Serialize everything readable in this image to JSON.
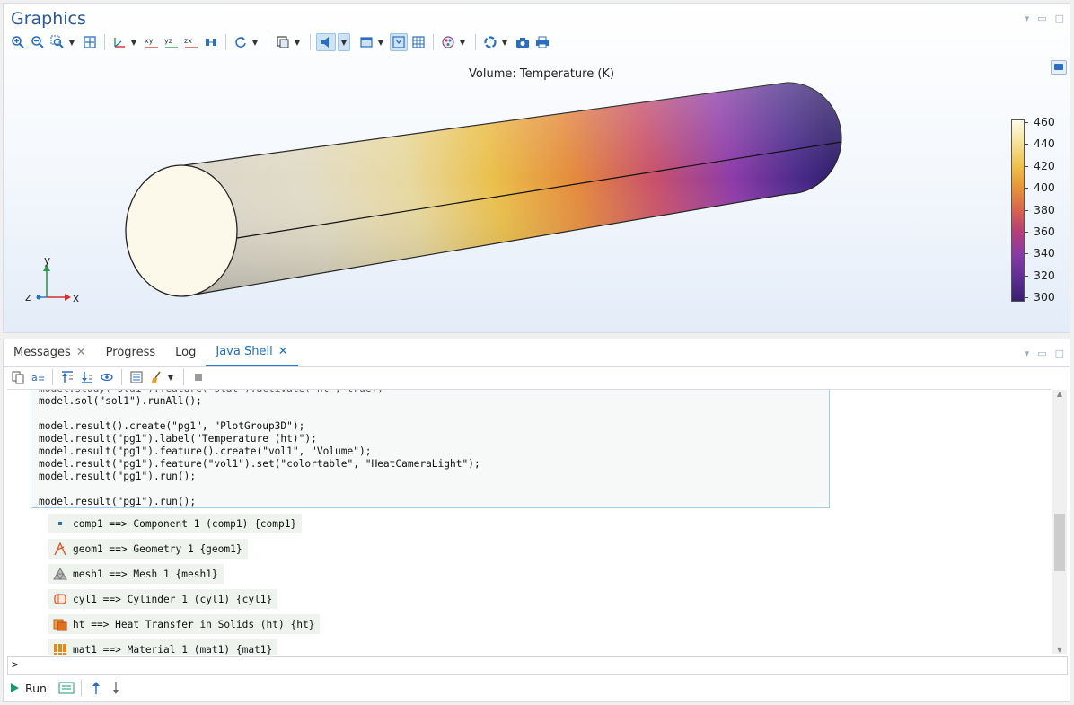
{
  "graphics": {
    "title": "Graphics",
    "plot_title": "Volume: Temperature (K)",
    "legend": {
      "ticks": [
        "460",
        "440",
        "420",
        "400",
        "380",
        "360",
        "340",
        "320",
        "300"
      ],
      "colormap": "HeatCameraLight"
    },
    "axes": {
      "y": "y",
      "x": "x",
      "z": "z"
    },
    "toolbar_icons": [
      "zoom-in-icon",
      "zoom-out-icon",
      "zoom-box-icon",
      "zoom-extents-icon",
      "views-icon",
      "xy-view-icon",
      "yz-view-icon",
      "zx-view-icon",
      "orthographic-icon",
      "reset-view-icon",
      "select-icon",
      "transparency-icon",
      "scene-light-icon",
      "wireframe-icon",
      "grid-icon",
      "rendering-icon",
      "colors-icon",
      "snapshot-icon",
      "print-icon"
    ]
  },
  "bottom": {
    "tabs": [
      {
        "label": "Messages",
        "closable": true
      },
      {
        "label": "Progress",
        "closable": false
      },
      {
        "label": "Log",
        "closable": false
      },
      {
        "label": "Java Shell",
        "closable": true,
        "active": true
      }
    ],
    "code_lines": [
      "model.sol(\"sol1\").runAll();",
      "",
      "model.result().create(\"pg1\", \"PlotGroup3D\");",
      "model.result(\"pg1\").label(\"Temperature (ht)\");",
      "model.result(\"pg1\").feature().create(\"vol1\", \"Volume\");",
      "model.result(\"pg1\").feature(\"vol1\").set(\"colortable\", \"HeatCameraLight\");",
      "model.result(\"pg1\").run();",
      "",
      "model.result(\"pg1\").run();"
    ],
    "results": [
      {
        "icon": "component-icon",
        "text": "comp1 ==> Component 1 (comp1) {comp1}"
      },
      {
        "icon": "geometry-icon",
        "text": "geom1 ==> Geometry 1 {geom1}"
      },
      {
        "icon": "mesh-icon",
        "text": "mesh1 ==> Mesh 1 {mesh1}"
      },
      {
        "icon": "cylinder-icon",
        "text": "cyl1 ==> Cylinder 1 (cyl1) {cyl1}"
      },
      {
        "icon": "heat-transfer-icon",
        "text": "ht ==> Heat Transfer in Solids (ht) {ht}"
      },
      {
        "icon": "material-icon",
        "text": "mat1 ==> Material 1 (mat1) {mat1}"
      }
    ],
    "prompt": ">",
    "run_label": "Run"
  },
  "colors": {
    "accent": "#2b5797",
    "tab_active": "#1f6fbf",
    "run_green": "#1b9a6b"
  }
}
